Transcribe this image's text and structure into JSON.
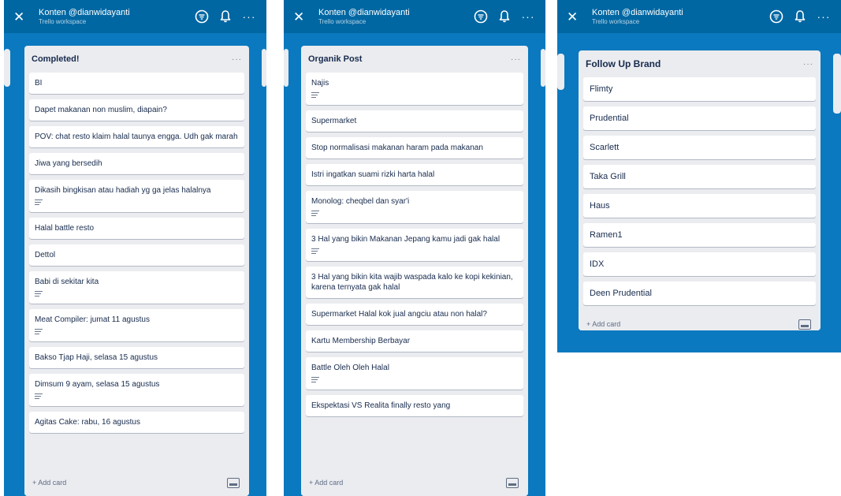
{
  "header": {
    "title": "Konten @dianwidayanti",
    "subtitle": "Trello workspace"
  },
  "lists": [
    {
      "title": "Completed!",
      "add_card": "+ Add card",
      "cards": [
        {
          "text": "BI",
          "desc": false
        },
        {
          "text": "Dapet makanan non muslim, diapain?",
          "desc": false
        },
        {
          "text": "POV: chat resto klaim halal taunya engga. Udh gak marah",
          "desc": false
        },
        {
          "text": "Jiwa yang bersedih",
          "desc": false
        },
        {
          "text": "Dikasih bingkisan atau hadiah yg ga jelas halalnya",
          "desc": true
        },
        {
          "text": "Halal battle resto",
          "desc": false
        },
        {
          "text": "Dettol",
          "desc": false
        },
        {
          "text": "Babi di sekitar kita",
          "desc": true
        },
        {
          "text": "Meat Compiler: jumat 11 agustus",
          "desc": true
        },
        {
          "text": "Bakso Tjap Haji, selasa 15 agustus",
          "desc": false
        },
        {
          "text": "Dimsum 9 ayam, selasa 15 agustus",
          "desc": true
        },
        {
          "text": "Agitas Cake: rabu, 16 agustus",
          "desc": false
        }
      ]
    },
    {
      "title": "Organik Post",
      "add_card": "+ Add card",
      "cards": [
        {
          "text": "Najis",
          "desc": true
        },
        {
          "text": "Supermarket",
          "desc": false
        },
        {
          "text": "Stop normalisasi makanan haram pada makanan",
          "desc": false
        },
        {
          "text": "Istri ingatkan suami rizki harta halal",
          "desc": false
        },
        {
          "text": "Monolog: cheqbel dan syar'i",
          "desc": true
        },
        {
          "text": "3 Hal yang bikin Makanan Jepang kamu jadi gak halal",
          "desc": true
        },
        {
          "text": "3 Hal yang bikin kita wajib waspada kalo ke kopi kekinian, karena ternyata gak halal",
          "desc": false
        },
        {
          "text": "Supermarket Halal kok jual angciu atau non halal?",
          "desc": false
        },
        {
          "text": "Kartu Membership Berbayar",
          "desc": false
        },
        {
          "text": "Battle Oleh Oleh Halal",
          "desc": true
        },
        {
          "text": "Ekspektasi VS Realita finally resto yang",
          "desc": false
        }
      ]
    },
    {
      "title": "Follow Up Brand",
      "add_card": "+ Add card",
      "cards": [
        {
          "text": "Flimty",
          "desc": false
        },
        {
          "text": "Prudential",
          "desc": false
        },
        {
          "text": "Scarlett",
          "desc": false
        },
        {
          "text": "Taka Grill",
          "desc": false
        },
        {
          "text": "Haus",
          "desc": false
        },
        {
          "text": "Ramen1",
          "desc": false
        },
        {
          "text": "IDX",
          "desc": false
        },
        {
          "text": "Deen Prudential",
          "desc": false
        }
      ]
    }
  ]
}
